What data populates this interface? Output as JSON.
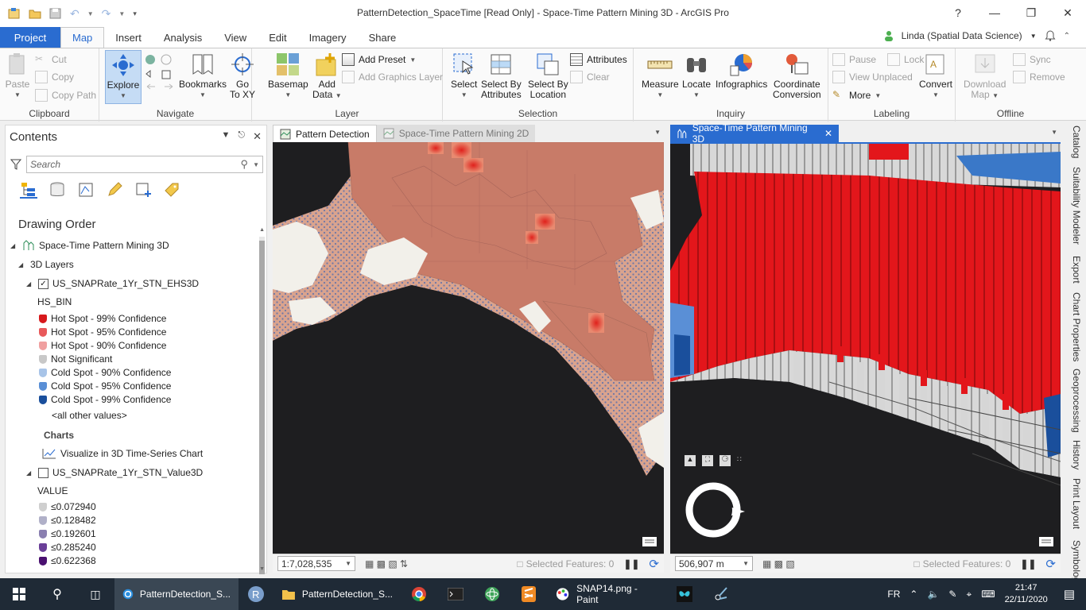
{
  "window": {
    "title": "PatternDetection_SpaceTime [Read Only] - Space-Time Pattern Mining 3D - ArcGIS Pro",
    "help": "?",
    "minimize": "—",
    "maximize": "❐",
    "close": "✕"
  },
  "ribbon_tabs": [
    "Project",
    "Map",
    "Insert",
    "Analysis",
    "View",
    "Edit",
    "Imagery",
    "Share"
  ],
  "user": {
    "name": "Linda (Spatial Data Science)"
  },
  "ribbon": {
    "clipboard": {
      "label": "Clipboard",
      "paste": "Paste",
      "cut": "Cut",
      "copy": "Copy",
      "copy_path": "Copy Path"
    },
    "navigate": {
      "label": "Navigate",
      "explore": "Explore",
      "bookmarks": "Bookmarks",
      "go_to_xy_1": "Go",
      "go_to_xy_2": "To XY"
    },
    "layer": {
      "label": "Layer",
      "basemap": "Basemap",
      "add_data_1": "Add",
      "add_data_2": "Data",
      "add_preset": "Add Preset",
      "add_graphics_layer": "Add Graphics Layer"
    },
    "selection": {
      "label": "Selection",
      "select": "Select",
      "select_by_attr_1": "Select By",
      "select_by_attr_2": "Attributes",
      "select_by_loc_1": "Select By",
      "select_by_loc_2": "Location",
      "attributes": "Attributes",
      "clear": "Clear"
    },
    "inquiry": {
      "label": "Inquiry",
      "measure": "Measure",
      "locate": "Locate",
      "infographics": "Infographics",
      "coord_1": "Coordinate",
      "coord_2": "Conversion"
    },
    "labeling": {
      "label": "Labeling",
      "pause": "Pause",
      "lock": "Lock",
      "view_unplaced": "View Unplaced",
      "more": "More",
      "convert": "Convert"
    },
    "offline": {
      "label": "Offline",
      "download_1": "Download",
      "download_2": "Map",
      "sync": "Sync",
      "remove": "Remove"
    }
  },
  "contents": {
    "title": "Contents",
    "search_placeholder": "Search",
    "drawing_order": "Drawing Order",
    "map_name": "Space-Time Pattern Mining 3D",
    "group_3d": "3D Layers",
    "layer1": {
      "name": "US_SNAPRate_1Yr_STN_EHS3D",
      "field": "HS_BIN",
      "classes": [
        {
          "label": "Hot Spot - 99% Confidence",
          "color": "#d7191c"
        },
        {
          "label": "Hot Spot - 95% Confidence",
          "color": "#e8595a"
        },
        {
          "label": "Hot Spot - 90% Confidence",
          "color": "#f0a0a0"
        },
        {
          "label": "Not Significant",
          "color": "#c8c8c8"
        },
        {
          "label": "Cold Spot - 90% Confidence",
          "color": "#a8c4e8"
        },
        {
          "label": "Cold Spot - 95% Confidence",
          "color": "#5a8fd6"
        },
        {
          "label": "Cold Spot - 99% Confidence",
          "color": "#1a4f9c"
        }
      ],
      "other": "<all other values>",
      "charts_header": "Charts",
      "chart_item": "Visualize in 3D Time-Series Chart"
    },
    "layer2": {
      "name": "US_SNAPRate_1Yr_STN_Value3D",
      "field": "VALUE",
      "classes": [
        {
          "label": "≤0.072940",
          "color": "#cfcfcf"
        },
        {
          "label": "≤0.128482",
          "color": "#b0b0c8"
        },
        {
          "label": "≤0.192601",
          "color": "#8a7fb0"
        },
        {
          "label": "≤0.285240",
          "color": "#6a3f98"
        },
        {
          "label": "≤0.622368",
          "color": "#4a1070"
        }
      ]
    }
  },
  "map_tabs": {
    "left": [
      "Pattern Detection",
      "Space-Time Pattern Mining 2D"
    ],
    "right": "Space-Time Pattern Mining 3D"
  },
  "status": {
    "left_scale": "1:7,028,535",
    "right_scale": "506,907 m",
    "selected_features": "Selected Features: 0"
  },
  "right_dock": [
    "Catalog",
    "Suitability Modeler",
    "Export",
    "Chart Properties",
    "Geoprocessing",
    "History",
    "Print Layout",
    "Symbology"
  ],
  "taskbar": {
    "apps": [
      "PatternDetection_S...",
      "PatternDetection_S...",
      "SNAP14.png - Paint"
    ],
    "lang": "FR",
    "time": "21:47",
    "date": "22/11/2020"
  },
  "colors": {
    "accent": "#2a6cd0",
    "hot": "#e3161b",
    "land_2d": "#c87b68"
  }
}
